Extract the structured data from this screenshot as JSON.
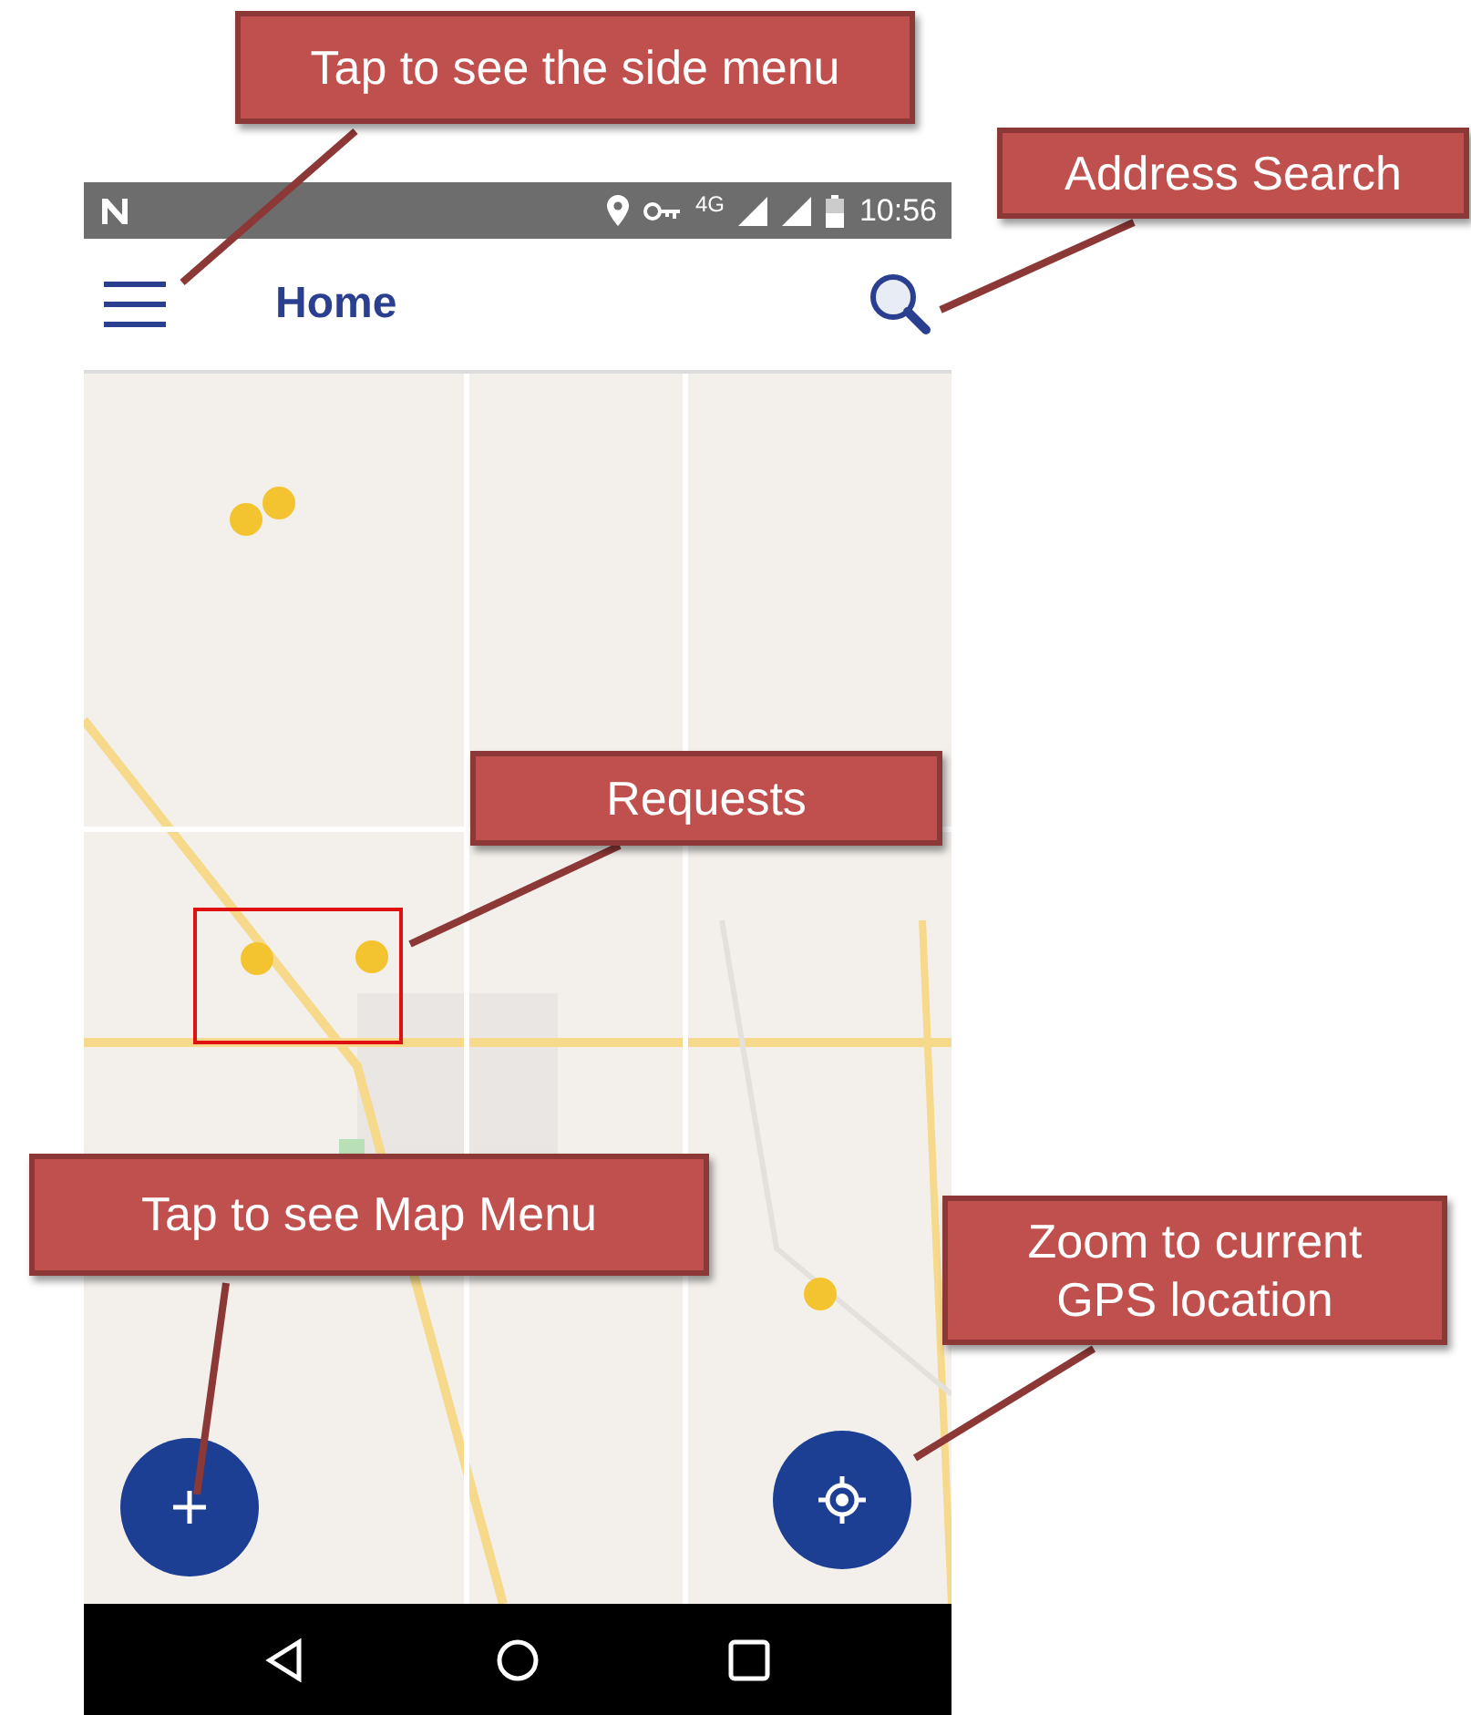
{
  "status_bar": {
    "network": "4G",
    "time": "10:56"
  },
  "app_bar": {
    "title": "Home"
  },
  "fabs": [
    {
      "kind": "add"
    },
    {
      "kind": "locate"
    }
  ],
  "nav_bar": {
    "buttons": [
      {
        "kind": "back"
      },
      {
        "kind": "home"
      },
      {
        "kind": "recents"
      }
    ]
  },
  "callouts": [
    {
      "text": "Tap to see the side menu"
    },
    {
      "text": "Address Search"
    },
    {
      "text": "Requests"
    },
    {
      "text": "Tap to see Map Menu"
    },
    {
      "text": "Zoom to current GPS location"
    }
  ]
}
